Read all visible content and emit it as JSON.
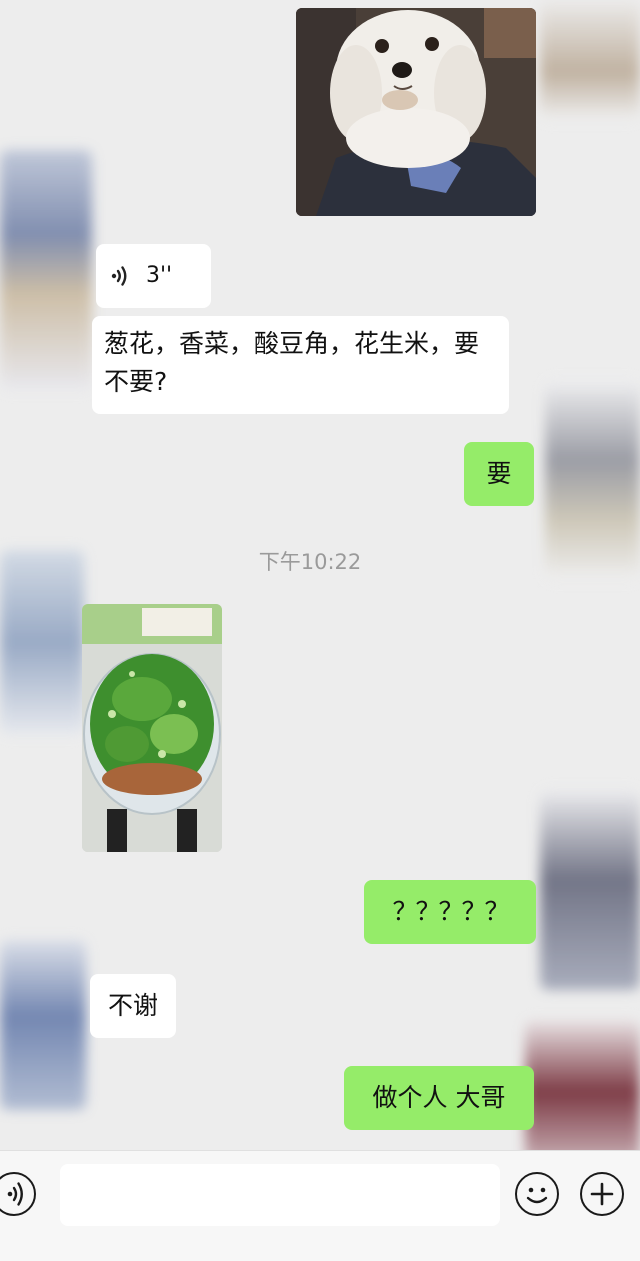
{
  "chat": {
    "voice_duration": "3''",
    "msg_left_1": "葱花，香菜，酸豆角，花生米，要不要?",
    "msg_right_1": "要",
    "timestamp": "下午10:22",
    "msg_right_2": "？？？？？",
    "msg_left_2": "不谢",
    "msg_right_3": "做个人 大哥"
  },
  "input_bar": {
    "placeholder": ""
  },
  "colors": {
    "background": "#ededed",
    "bubble_left": "#ffffff",
    "bubble_right": "#95ec69"
  },
  "icons": [
    "voice-icon",
    "voice-input-icon",
    "emoji-icon",
    "add-icon"
  ]
}
